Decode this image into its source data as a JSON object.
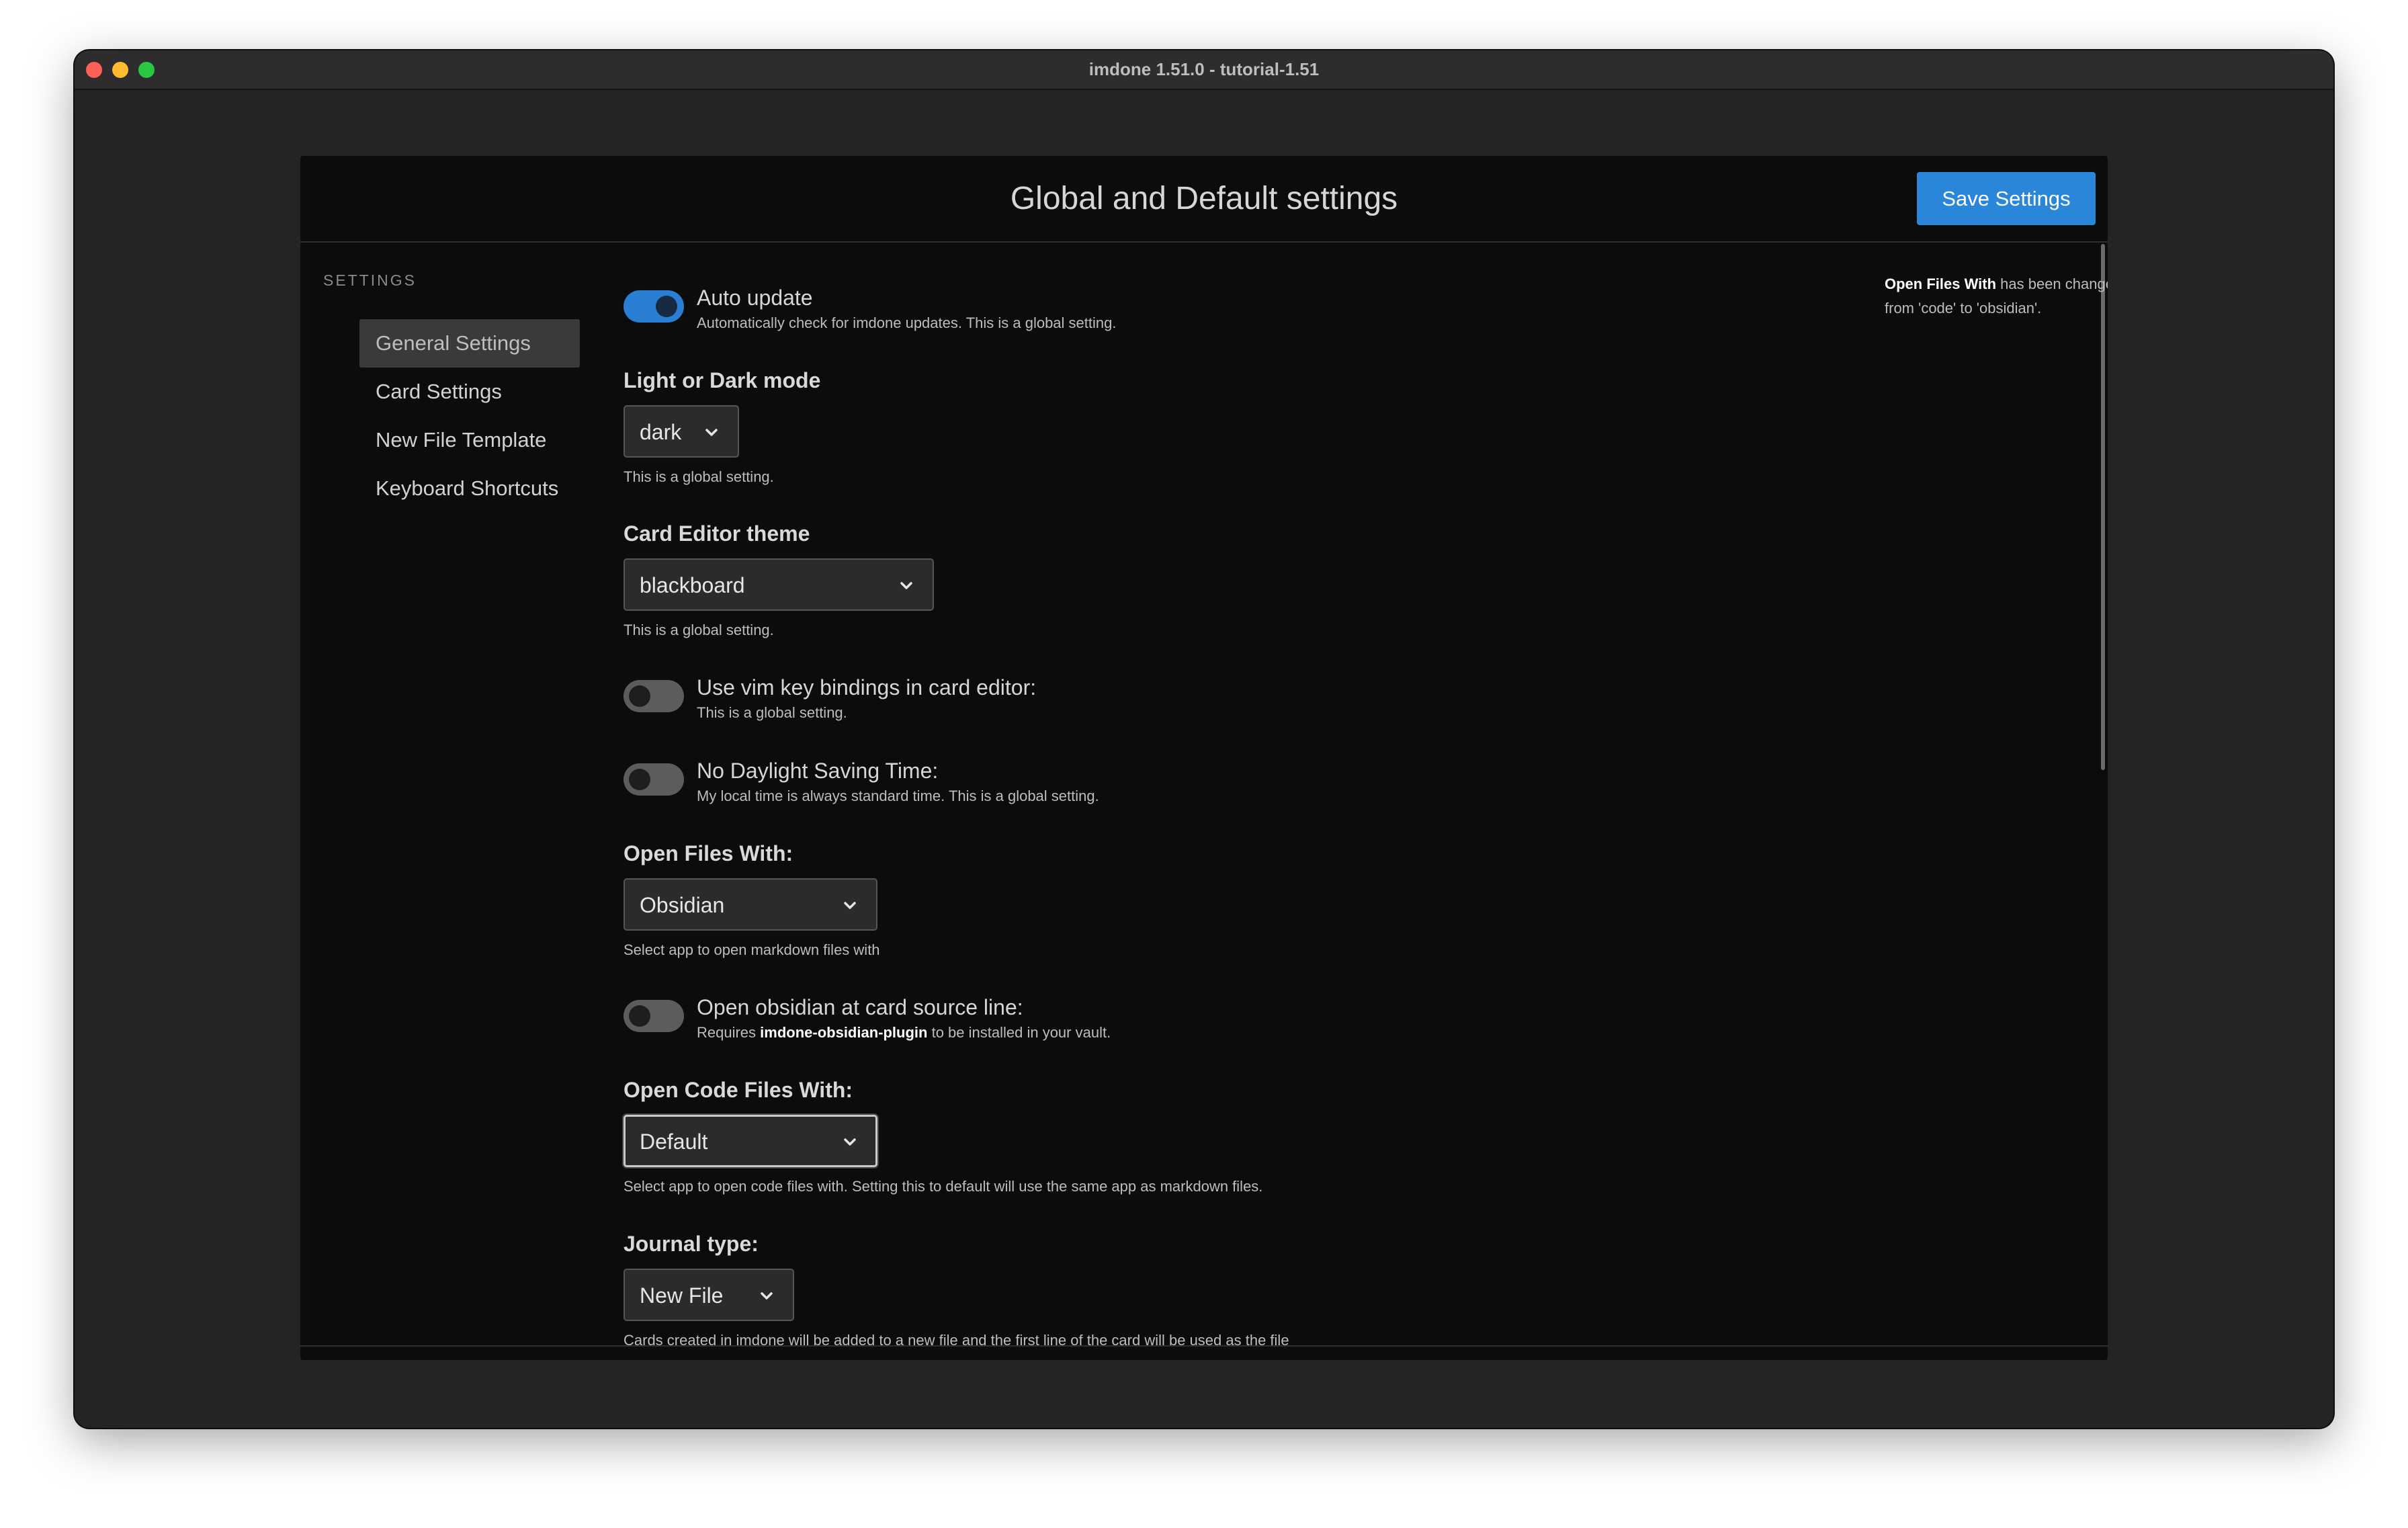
{
  "window": {
    "title": "imdone 1.51.0 - tutorial-1.51"
  },
  "dialog": {
    "title": "Global and Default settings",
    "save_label": "Save Settings",
    "close_label": "×"
  },
  "sidebar": {
    "heading": "SETTINGS",
    "items": [
      {
        "label": "General Settings",
        "active": true
      },
      {
        "label": "Card Settings"
      },
      {
        "label": "New File Template"
      },
      {
        "label": "Keyboard Shortcuts"
      }
    ]
  },
  "notice": {
    "bold": "Open Files With",
    "text": " has been changed from 'code' to 'obsidian'."
  },
  "settings": {
    "auto_update": {
      "title": "Auto update",
      "help": "Automatically check for imdone updates. This is a global setting.",
      "enabled": true
    },
    "mode": {
      "label": "Light or Dark mode",
      "value": "dark",
      "help": "This is a global setting."
    },
    "editor_theme": {
      "label": "Card Editor theme",
      "value": "blackboard",
      "help": "This is a global setting."
    },
    "vim": {
      "title": "Use vim key bindings in card editor:",
      "help": "This is a global setting.",
      "enabled": false
    },
    "dst": {
      "title": "No Daylight Saving Time:",
      "help": "My local time is always standard time. This is a global setting.",
      "enabled": false
    },
    "open_files": {
      "label": "Open Files With:",
      "value": "Obsidian",
      "help": "Select app to open markdown files with"
    },
    "obsidian_line": {
      "title": "Open obsidian at card source line:",
      "help_pre": "Requires ",
      "help_bold": "imdone-obsidian-plugin",
      "help_post": " to be installed in your vault.",
      "enabled": false
    },
    "open_code": {
      "label": "Open Code Files With:",
      "value": "Default",
      "help": "Select app to open code files with. Setting this to default will use the same app as markdown files."
    },
    "journal": {
      "label": "Journal type:",
      "value": "New File",
      "help": "Cards created in imdone will be added to a new file and the first line of the card will be used as the file"
    }
  },
  "colors": {
    "accent": "#2a86d8",
    "toggle_on": "#2a7fd4",
    "dialog_bg": "#0c0c0d",
    "window_bg": "#242424"
  },
  "icons": {
    "select_arrow": "chevron-down-icon",
    "close": "close-icon"
  }
}
